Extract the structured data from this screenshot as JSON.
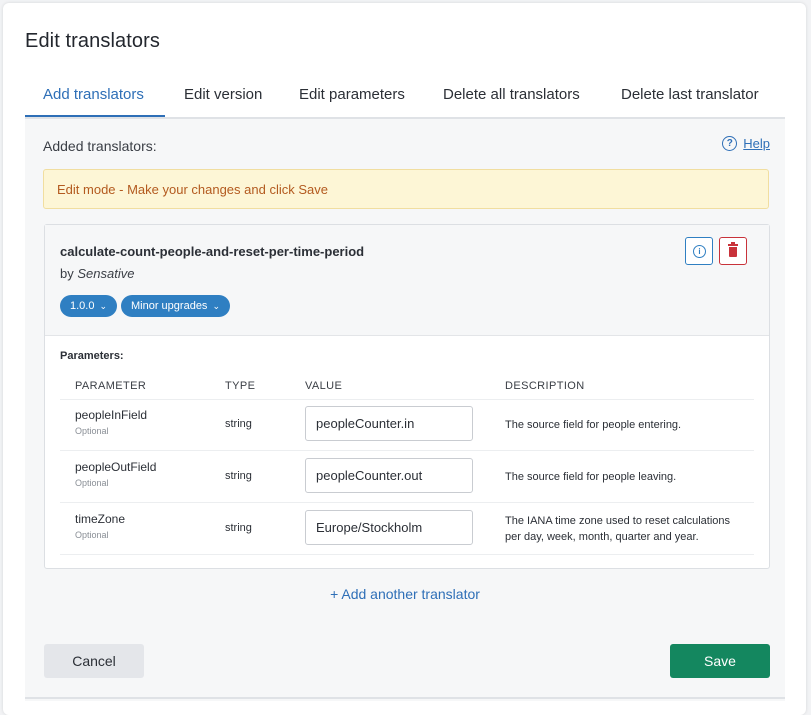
{
  "title": "Edit translators",
  "tabs": [
    {
      "label": "Add translators"
    },
    {
      "label": "Edit version"
    },
    {
      "label": "Edit parameters"
    },
    {
      "label": "Delete all translators"
    },
    {
      "label": "Delete last translator"
    }
  ],
  "added_label": "Added translators:",
  "help": {
    "label": "Help",
    "icon": "question-circle-icon"
  },
  "edit_mode_alert": "Edit mode - Make your changes and click Save",
  "translator": {
    "name": "calculate-count-people-and-reset-per-time-period",
    "by_prefix": "by",
    "vendor": "Sensative",
    "version": "1.0.0",
    "upgrade_policy": "Minor upgrades",
    "parameters_label": "Parameters:",
    "columns": [
      "PARAMETER",
      "TYPE",
      "VALUE",
      "DESCRIPTION"
    ],
    "parameters": [
      {
        "name": "peopleInField",
        "optional": "Optional",
        "type": "string",
        "value": "peopleCounter.in",
        "description": "The source field for people entering."
      },
      {
        "name": "peopleOutField",
        "optional": "Optional",
        "type": "string",
        "value": "peopleCounter.out",
        "description": "The source field for people leaving."
      },
      {
        "name": "timeZone",
        "optional": "Optional",
        "type": "string",
        "value": "Europe/Stockholm",
        "description": "The IANA time zone used to reset calculations per day, week, month, quarter and year."
      }
    ]
  },
  "add_another": "+ Add another translator",
  "buttons": {
    "cancel": "Cancel",
    "save": "Save"
  },
  "colors": {
    "accent": "#2e6fb7",
    "pill": "#2f7fc2",
    "save": "#14875f",
    "danger": "#c8323a",
    "alert_bg": "#fdf6d6",
    "alert_text": "#b35a1f"
  }
}
